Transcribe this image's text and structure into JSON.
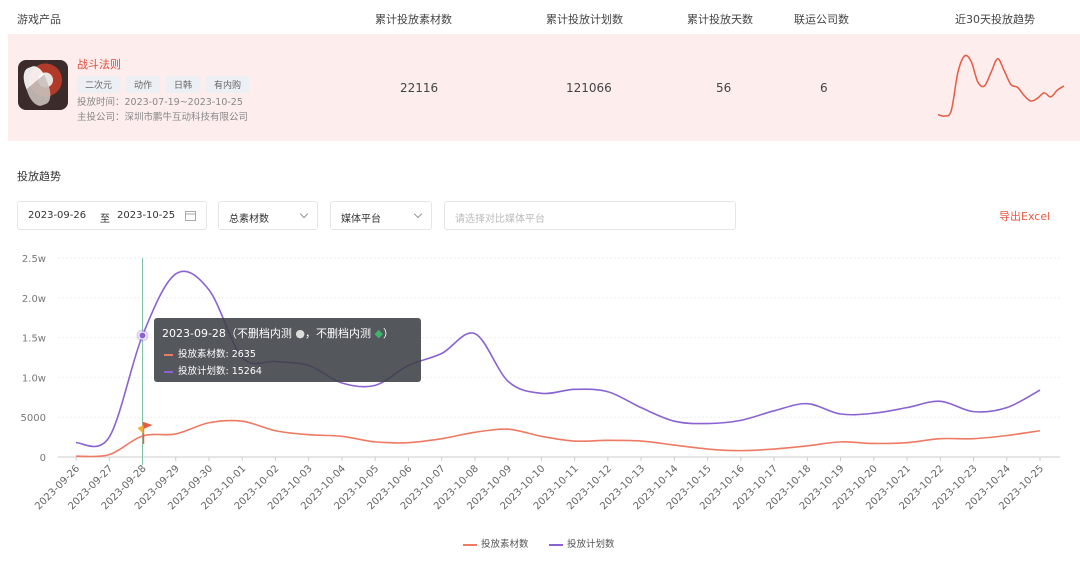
{
  "header": {
    "col_product": "游戏产品",
    "col_materials": "累计投放素材数",
    "col_plans": "累计投放计划数",
    "col_days": "累计投放天数",
    "col_companies": "联运公司数",
    "col_trend": "近30天投放趋势"
  },
  "product": {
    "name": "战斗法则",
    "tags": [
      "二次元",
      "动作",
      "日韩",
      "有内购"
    ],
    "period": "投放时间：2023-07-19~2023-10-25",
    "company": "主投公司：深圳市鹏牛互动科技有限公司",
    "materials": "22116",
    "plans": "121066",
    "days": "56",
    "companies": "6"
  },
  "section_title": "投放趋势",
  "filters": {
    "date_start": "2023-09-26",
    "date_sep": "至",
    "date_end": "2023-10-25",
    "metric": "总素材数",
    "platform": "媒体平台",
    "compare_placeholder": "请选择对比媒体平台",
    "export": "导出Excel"
  },
  "tooltip": {
    "title": "2023-09-28（不删档内测",
    "title_mid": "，不删档内测",
    "title_end": "）",
    "s1_label": "投放素材数: 2635",
    "s2_label": "投放计划数: 15264"
  },
  "colors": {
    "materials": "#ef7a63",
    "plans": "#8a63d2",
    "accent": "#e85a44",
    "row_bg": "#fdeeed"
  },
  "chart_data": {
    "type": "line",
    "x": [
      "2023-09-26",
      "2023-09-27",
      "2023-09-28",
      "2023-09-29",
      "2023-09-30",
      "2023-10-01",
      "2023-10-02",
      "2023-10-03",
      "2023-10-04",
      "2023-10-05",
      "2023-10-06",
      "2023-10-07",
      "2023-10-08",
      "2023-10-09",
      "2023-10-10",
      "2023-10-11",
      "2023-10-12",
      "2023-10-13",
      "2023-10-14",
      "2023-10-15",
      "2023-10-16",
      "2023-10-17",
      "2023-10-18",
      "2023-10-19",
      "2023-10-20",
      "2023-10-21",
      "2023-10-22",
      "2023-10-23",
      "2023-10-24",
      "2023-10-25"
    ],
    "series": [
      {
        "name": "投放素材数",
        "values": [
          100,
          300,
          2635,
          2900,
          4300,
          4500,
          3300,
          2800,
          2600,
          1900,
          1800,
          2300,
          3100,
          3500,
          2600,
          2000,
          2100,
          2000,
          1500,
          1000,
          800,
          1000,
          1400,
          1900,
          1700,
          1800,
          2300,
          2300,
          2700,
          3300
        ]
      },
      {
        "name": "投放计划数",
        "values": [
          1800,
          2500,
          15264,
          23000,
          21000,
          12500,
          12000,
          11500,
          9300,
          9000,
          11500,
          13000,
          15500,
          9500,
          8000,
          8500,
          8200,
          6200,
          4500,
          4200,
          4600,
          5800,
          6700,
          5400,
          5500,
          6200,
          7000,
          5700,
          6200,
          8400
        ]
      }
    ],
    "y_ticks": [
      "0",
      "5000",
      "1.0w",
      "1.5w",
      "2.0w",
      "2.5w"
    ],
    "ylim": [
      0,
      25000
    ],
    "highlight_index": 2,
    "legend_position": "bottom",
    "trend_sparkline": [
      2100,
      2000,
      2400,
      5200,
      6400,
      6000,
      4500,
      4200,
      5200,
      6200,
      5300,
      4300,
      4100,
      3500,
      3100,
      3300,
      3700,
      3400,
      3900,
      4200
    ]
  }
}
